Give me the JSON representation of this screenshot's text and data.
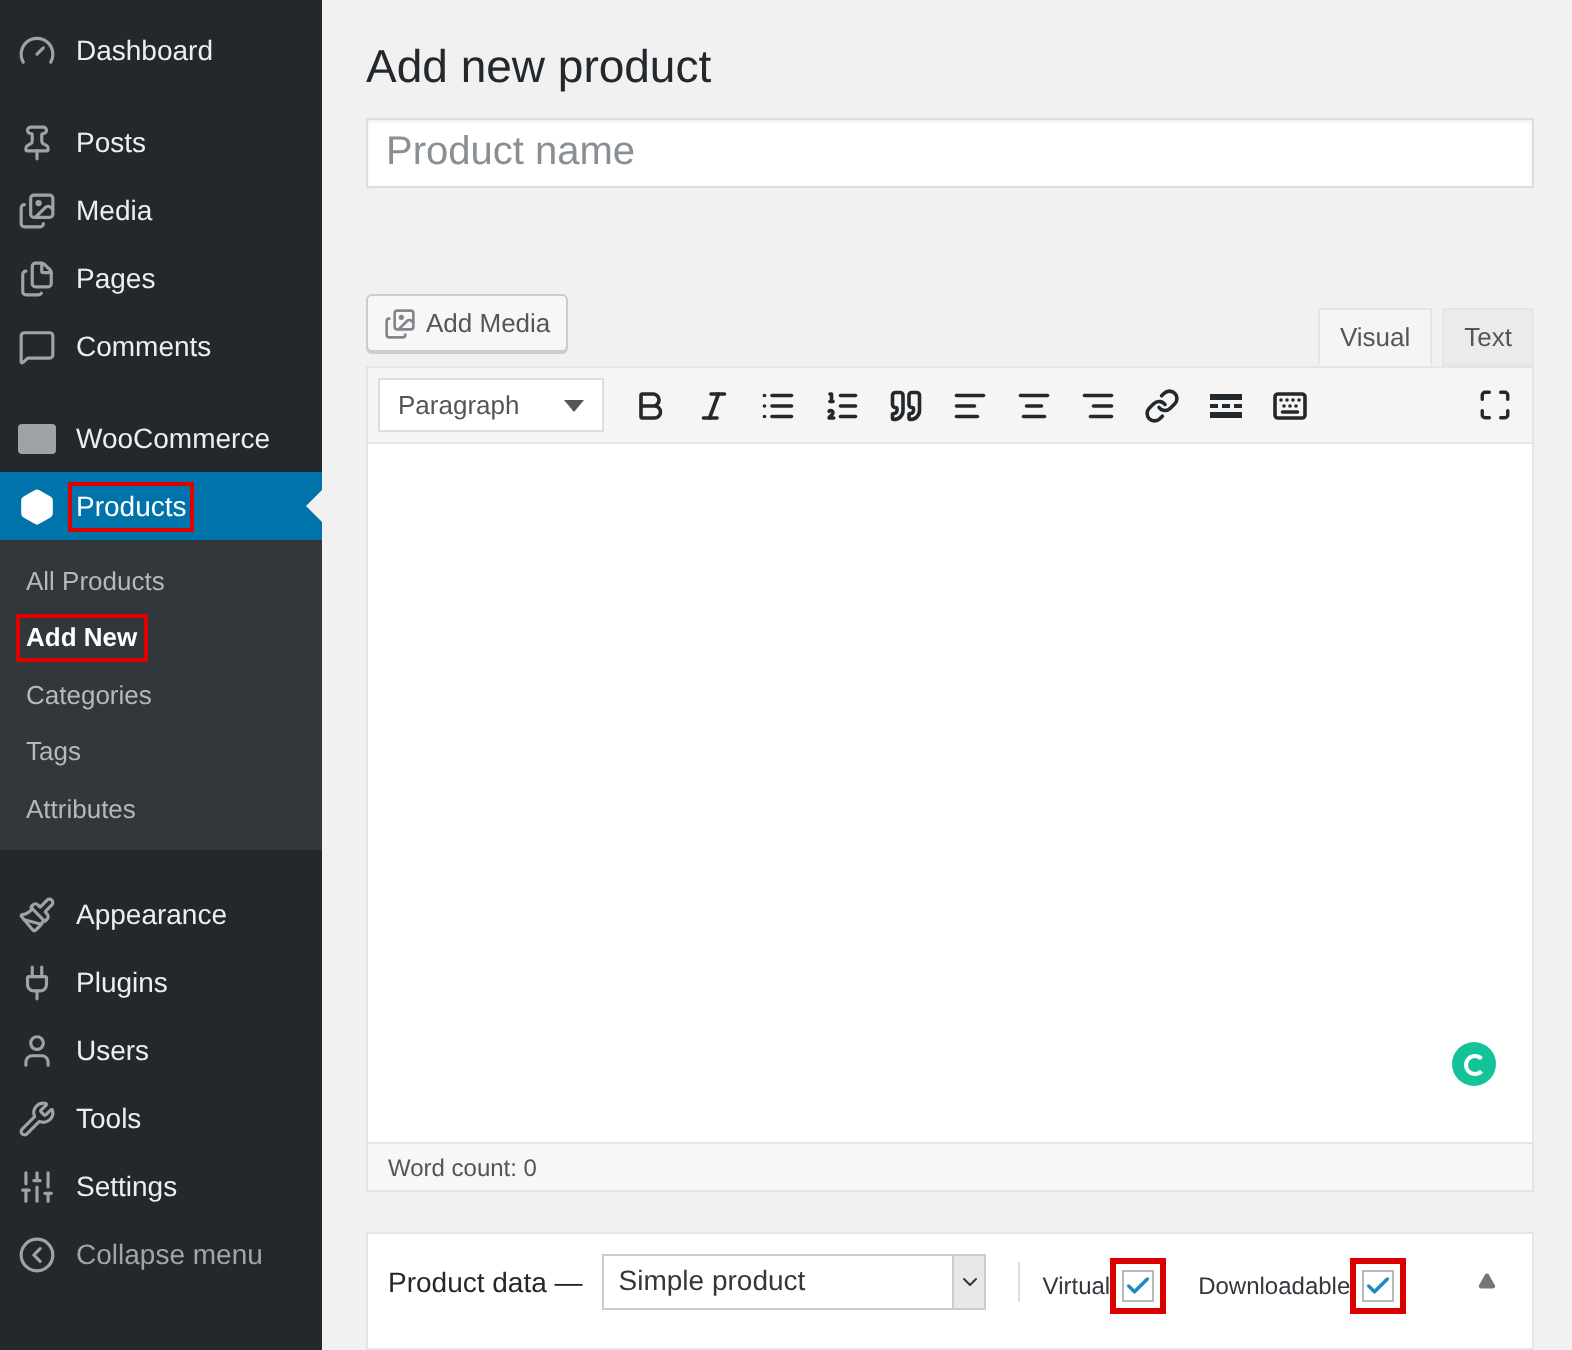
{
  "sidebar": {
    "groups": [
      {
        "items": [
          {
            "label": "Dashboard",
            "selected": false,
            "annotated": false
          }
        ]
      },
      {
        "items": [
          {
            "label": "Posts",
            "selected": false,
            "annotated": false
          },
          {
            "label": "Media",
            "selected": false,
            "annotated": false
          },
          {
            "label": "Pages",
            "selected": false,
            "annotated": false
          },
          {
            "label": "Comments",
            "selected": false,
            "annotated": false
          }
        ]
      },
      {
        "items": [
          {
            "label": "WooCommerce",
            "selected": false,
            "annotated": false
          },
          {
            "label": "Products",
            "selected": true,
            "annotated": true,
            "children": [
              {
                "label": "All Products",
                "selected": false,
                "annotated": false
              },
              {
                "label": "Add New",
                "selected": true,
                "annotated": true
              },
              {
                "label": "Categories",
                "selected": false,
                "annotated": false
              },
              {
                "label": "Tags",
                "selected": false,
                "annotated": false
              },
              {
                "label": "Attributes",
                "selected": false,
                "annotated": false
              }
            ]
          }
        ]
      },
      {
        "items": [
          {
            "label": "Appearance",
            "selected": false,
            "annotated": false
          },
          {
            "label": "Plugins",
            "selected": false,
            "annotated": false
          },
          {
            "label": "Users",
            "selected": false,
            "annotated": false
          },
          {
            "label": "Tools",
            "selected": false,
            "annotated": false
          },
          {
            "label": "Settings",
            "selected": false,
            "annotated": false
          },
          {
            "label": "Collapse menu",
            "selected": false,
            "annotated": false,
            "muted": true
          }
        ]
      }
    ]
  },
  "page": {
    "title": "Add new product",
    "name_field": {
      "placeholder": "Product name"
    }
  },
  "editor": {
    "add_media": "Add Media",
    "tabs": [
      {
        "label": "Visual",
        "selected": true
      },
      {
        "label": "Text",
        "selected": false
      }
    ],
    "format_select": "Paragraph",
    "word_count": "Word count: 0"
  },
  "product_data": {
    "title": "Product data —",
    "type_select": "Simple product",
    "options": [
      {
        "label": "Virtual",
        "checked": true,
        "annotated": true
      },
      {
        "label": "Downloadable",
        "checked": true,
        "annotated": true
      }
    ]
  }
}
